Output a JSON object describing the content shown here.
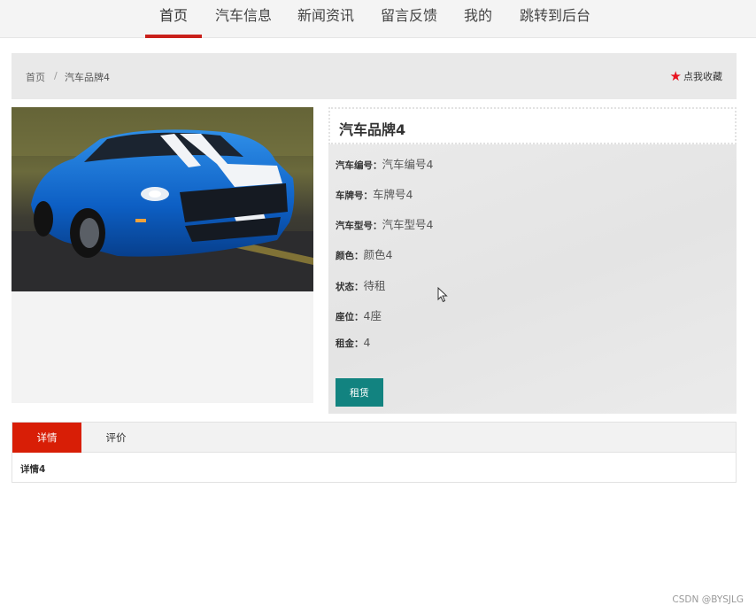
{
  "nav": {
    "items": [
      {
        "label": "首页",
        "active": true
      },
      {
        "label": "汽车信息"
      },
      {
        "label": "新闻资讯"
      },
      {
        "label": "留言反馈"
      },
      {
        "label": "我的"
      },
      {
        "label": "跳转到后台"
      }
    ],
    "accent_color": "#c9201a"
  },
  "breadcrumb": {
    "home": "首页",
    "separator": "/",
    "current": "汽车品牌4"
  },
  "favorite": {
    "icon": "star-icon",
    "label": "点我收藏"
  },
  "product": {
    "image_icon": "car-photo",
    "title": "汽车品牌4",
    "fields": [
      {
        "key": "汽车编号：",
        "value": "汽车编号4"
      },
      {
        "key": "车牌号：",
        "value": "车牌号4"
      },
      {
        "key": "汽车型号：",
        "value": "汽车型号4"
      },
      {
        "key": "颜色：",
        "value": "颜色4"
      },
      {
        "key": "状态：",
        "value": "待租"
      },
      {
        "key": "座位：",
        "value": "4座"
      },
      {
        "key": "租金：",
        "value": "4"
      }
    ],
    "rent_button": "租赁",
    "button_color": "#128380"
  },
  "tabs": {
    "items": [
      {
        "label": "详情",
        "active": true
      },
      {
        "label": "评价"
      }
    ],
    "content": "详情4",
    "active_color": "#d81e06"
  },
  "watermark": "CSDN @BYSJLG"
}
